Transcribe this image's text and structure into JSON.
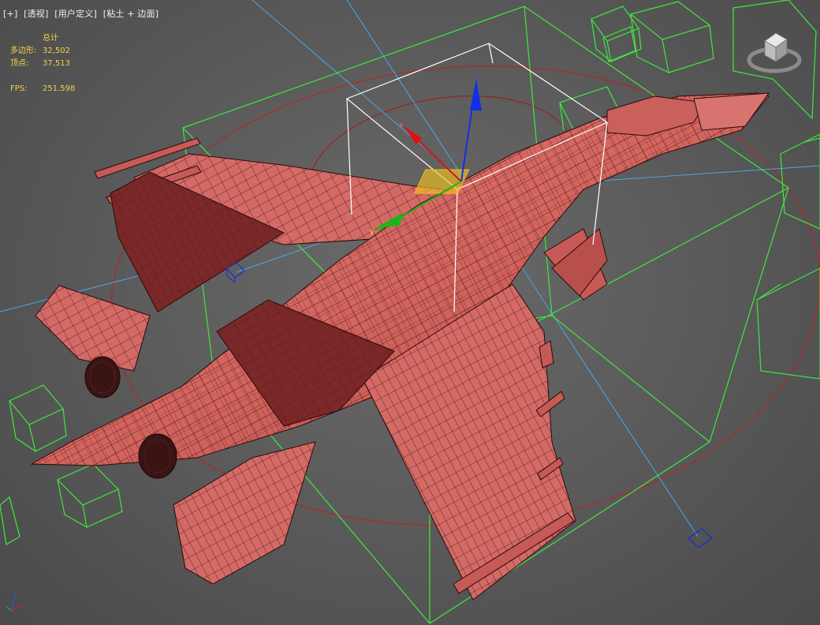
{
  "viewport": {
    "menu": {
      "plus_label": "[+]",
      "view_label": "[透视]",
      "shading_label": "[用户定义]",
      "mode_label": "[粘土 + 边面]"
    },
    "stats": {
      "header": "总计",
      "polygons_label": "多边形:",
      "polygons_value": "32,502",
      "vertices_label": "顶点:",
      "vertices_value": "37,513",
      "fps_label": "FPS:",
      "fps_value": "251.598"
    },
    "gizmo_axes": [
      "z",
      "x",
      "y"
    ],
    "colors": {
      "background": "#585858",
      "model_clay": "#d46a66",
      "model_shadow": "#7a2828",
      "wire": "#2a0a0a",
      "selection_bounds": "#ffffff",
      "helper_boxes": "#3ee83e",
      "camera_lines": "#4aa6e8",
      "orbit_circle": "#c21e1e",
      "stats_text": "#f2d24a",
      "gizmo_x": "#e01010",
      "gizmo_y": "#18b818",
      "gizmo_z": "#1030e8",
      "gizmo_plane": "#f0c020"
    }
  }
}
